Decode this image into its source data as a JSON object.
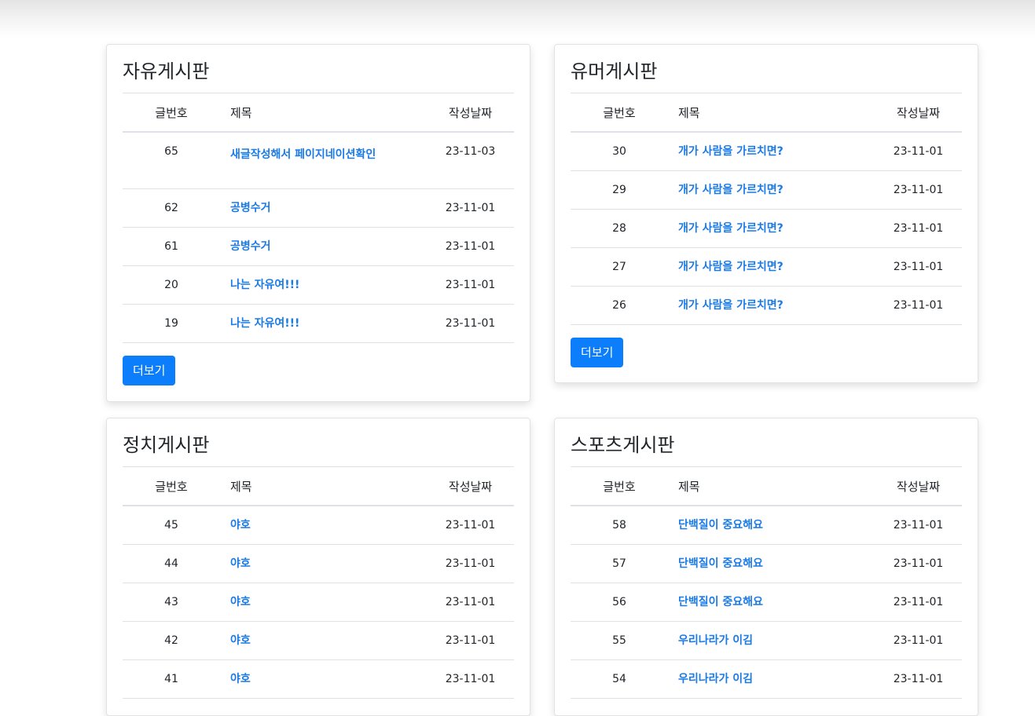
{
  "table_headers": {
    "num": "글번호",
    "title": "제목",
    "date": "작성날짜"
  },
  "more_label": "더보기",
  "boards": {
    "free": {
      "title": "자유게시판",
      "rows": [
        {
          "num": "65",
          "title": "새글작성해서 페이지네이션확인",
          "date": "23-11-03"
        },
        {
          "num": "62",
          "title": "공병수거",
          "date": "23-11-01"
        },
        {
          "num": "61",
          "title": "공병수거",
          "date": "23-11-01"
        },
        {
          "num": "20",
          "title": "나는 자유여!!!",
          "date": "23-11-01"
        },
        {
          "num": "19",
          "title": "나는 자유여!!!",
          "date": "23-11-01"
        }
      ]
    },
    "humor": {
      "title": "유머게시판",
      "rows": [
        {
          "num": "30",
          "title": "개가 사람을 가르치면?",
          "date": "23-11-01"
        },
        {
          "num": "29",
          "title": "개가 사람을 가르치면?",
          "date": "23-11-01"
        },
        {
          "num": "28",
          "title": "개가 사람을 가르치면?",
          "date": "23-11-01"
        },
        {
          "num": "27",
          "title": "개가 사람을 가르치면?",
          "date": "23-11-01"
        },
        {
          "num": "26",
          "title": "개가 사람을 가르치면?",
          "date": "23-11-01"
        }
      ]
    },
    "politics": {
      "title": "정치게시판",
      "rows": [
        {
          "num": "45",
          "title": "야호",
          "date": "23-11-01"
        },
        {
          "num": "44",
          "title": "야호",
          "date": "23-11-01"
        },
        {
          "num": "43",
          "title": "야호",
          "date": "23-11-01"
        },
        {
          "num": "42",
          "title": "야호",
          "date": "23-11-01"
        },
        {
          "num": "41",
          "title": "야호",
          "date": "23-11-01"
        }
      ]
    },
    "sports": {
      "title": "스포츠게시판",
      "rows": [
        {
          "num": "58",
          "title": "단백질이 중요해요",
          "date": "23-11-01"
        },
        {
          "num": "57",
          "title": "단백질이 중요해요",
          "date": "23-11-01"
        },
        {
          "num": "56",
          "title": "단백질이 중요해요",
          "date": "23-11-01"
        },
        {
          "num": "55",
          "title": "우리나라가 이김",
          "date": "23-11-01"
        },
        {
          "num": "54",
          "title": "우리나라가 이김",
          "date": "23-11-01"
        }
      ]
    }
  }
}
